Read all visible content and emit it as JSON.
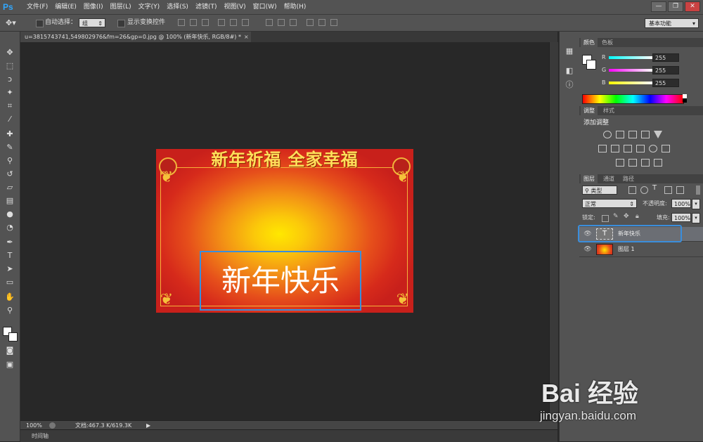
{
  "app": {
    "logo": "Ps"
  },
  "menu": [
    "文件(F)",
    "编辑(E)",
    "图像(I)",
    "图层(L)",
    "文字(Y)",
    "选择(S)",
    "滤镜(T)",
    "视图(V)",
    "窗口(W)",
    "帮助(H)"
  ],
  "window_controls": {
    "minimize": "—",
    "restore": "❐",
    "close": "✕"
  },
  "options": {
    "auto_select_label": "自动选择：",
    "group_value": "组",
    "show_transform_label": "显示变换控件"
  },
  "workspace": {
    "value": "基本功能"
  },
  "document": {
    "tab_label": "u=3815743741,549802976&fm=26&gp=0.jpg @ 100% (新年快乐, RGB/8#) *",
    "close_symbol": "×"
  },
  "image": {
    "banner_text": "新年祈福  全家幸福",
    "text_layer": "新年快乐"
  },
  "status": {
    "zoom": "100%",
    "doc_info": "文档:467.3 K/619.3K",
    "arrow": "▶"
  },
  "timeline": {
    "label": "时间轴"
  },
  "color_panel": {
    "tabs": [
      "颜色",
      "色板"
    ],
    "channels": [
      {
        "label": "R",
        "value": "255",
        "gradient": "linear-gradient(to right, #00ffff, #ffffff)"
      },
      {
        "label": "G",
        "value": "255",
        "gradient": "linear-gradient(to right, #ff00ff, #ffffff)"
      },
      {
        "label": "B",
        "value": "255",
        "gradient": "linear-gradient(to right, #ffff00, #ffffff)"
      }
    ]
  },
  "adjust_panel": {
    "tabs": [
      "调整",
      "样式"
    ],
    "title": "添加调整"
  },
  "layers_panel": {
    "tabs": [
      "图层",
      "通道",
      "路径"
    ],
    "filter_label": "类型",
    "blend_mode": "正常",
    "opacity_label": "不透明度:",
    "opacity_value": "100%",
    "lock_label": "锁定:",
    "fill_label": "填充:",
    "fill_value": "100%",
    "layers": [
      {
        "name": "新年快乐",
        "type": "text",
        "thumb_glyph": "T"
      },
      {
        "name": "图层 1",
        "type": "image"
      }
    ]
  },
  "watermark": {
    "brand": "Bai 经验",
    "url": "jingyan.baidu.com"
  },
  "colors": {
    "accent": "#31a8ff",
    "selection": "#3a8edc"
  }
}
